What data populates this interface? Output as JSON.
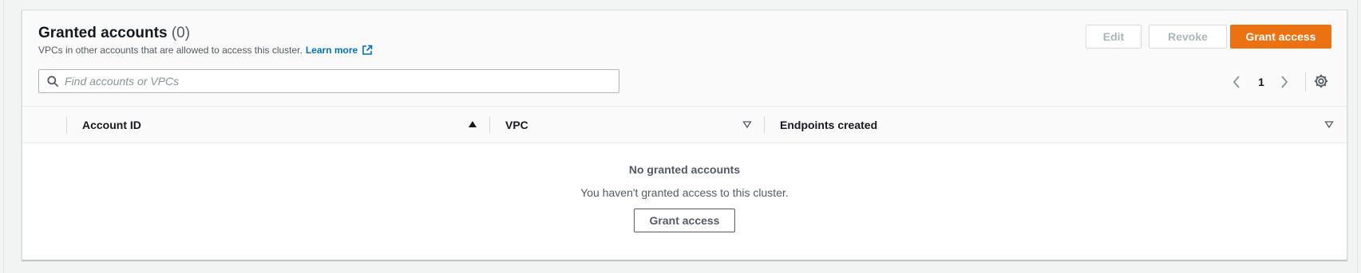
{
  "header": {
    "title": "Granted accounts",
    "count": "(0)",
    "description": "VPCs in other accounts that are allowed to access this cluster.",
    "learn_more": "Learn more",
    "external_icon": "external-link-icon"
  },
  "actions": {
    "edit_label": "Edit",
    "revoke_label": "Revoke",
    "grant_label": "Grant access",
    "edit_disabled": true,
    "revoke_disabled": true
  },
  "search": {
    "placeholder": "Find accounts or VPCs",
    "value": "",
    "icon": "search-icon"
  },
  "pagination": {
    "current_page": "1",
    "prev_icon": "chevron-left-icon",
    "next_icon": "chevron-right-icon",
    "settings_icon": "gear-icon"
  },
  "table": {
    "columns": [
      {
        "label": "Account ID",
        "sort": "ascending"
      },
      {
        "label": "VPC",
        "sort": "none"
      },
      {
        "label": "Endpoints created",
        "sort": "none"
      }
    ],
    "rows": []
  },
  "empty_state": {
    "title": "No granted accounts",
    "description": "You haven't granted access to this cluster.",
    "button_label": "Grant access"
  },
  "colors": {
    "primary": "#ec7211",
    "link": "#0073bb",
    "text": "#16191f",
    "muted": "#545b64",
    "disabled": "#aab7b8"
  }
}
